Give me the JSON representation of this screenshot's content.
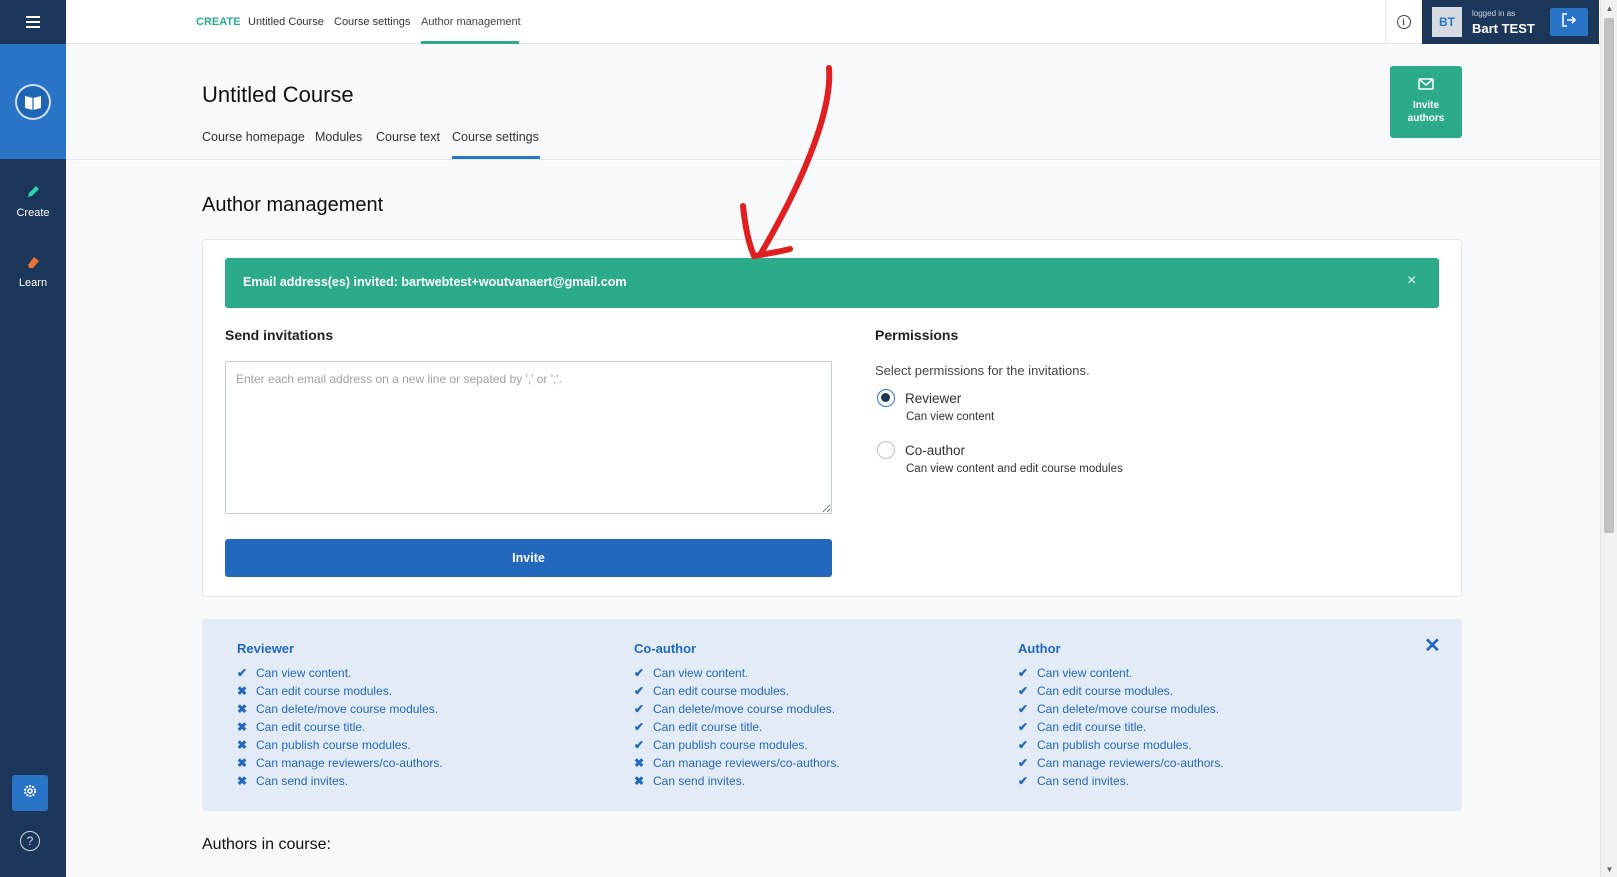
{
  "topbar": {
    "crumbs": [
      "CREATE",
      "Untitled Course",
      "Course settings",
      "Author management"
    ],
    "user": {
      "initials": "BT",
      "logged_in_label": "logged in as",
      "name": "Bart TEST"
    }
  },
  "sidebar": {
    "items": [
      {
        "label": "Create",
        "icon": "pencil-icon"
      },
      {
        "label": "Learn",
        "icon": "eraser-icon"
      }
    ]
  },
  "header": {
    "course_title": "Untitled Course",
    "tabs": [
      "Course homepage",
      "Modules",
      "Course text",
      "Course settings"
    ],
    "active_tab": "Course settings",
    "invite_authors_label": "Invite authors"
  },
  "main": {
    "section_title": "Author management",
    "alert": {
      "text": "Email address(es) invited: bartwebtest+woutvanaert@gmail.com",
      "close": "×"
    },
    "send": {
      "label": "Send invitations",
      "placeholder": "Enter each email address on a new line or sepated by ',' or ';'.",
      "button": "Invite"
    },
    "permissions": {
      "label": "Permissions",
      "subtitle": "Select permissions for the invitations.",
      "options": [
        {
          "label": "Reviewer",
          "desc": "Can view content",
          "checked": true
        },
        {
          "label": "Co-author",
          "desc": "Can view content and edit course modules",
          "checked": false
        }
      ]
    },
    "roles": [
      {
        "title": "Reviewer",
        "perms": [
          {
            "text": "Can view content.",
            "allowed": true
          },
          {
            "text": "Can edit course modules.",
            "allowed": false
          },
          {
            "text": "Can delete/move course modules.",
            "allowed": false
          },
          {
            "text": "Can edit course title.",
            "allowed": false
          },
          {
            "text": "Can publish course modules.",
            "allowed": false
          },
          {
            "text": "Can manage reviewers/co-authors.",
            "allowed": false
          },
          {
            "text": "Can send invites.",
            "allowed": false
          }
        ]
      },
      {
        "title": "Co-author",
        "perms": [
          {
            "text": "Can view content.",
            "allowed": true
          },
          {
            "text": "Can edit course modules.",
            "allowed": true
          },
          {
            "text": "Can delete/move course modules.",
            "allowed": true
          },
          {
            "text": "Can edit course title.",
            "allowed": true
          },
          {
            "text": "Can publish course modules.",
            "allowed": true
          },
          {
            "text": "Can manage reviewers/co-authors.",
            "allowed": false
          },
          {
            "text": "Can send invites.",
            "allowed": false
          }
        ]
      },
      {
        "title": "Author",
        "perms": [
          {
            "text": "Can view content.",
            "allowed": true
          },
          {
            "text": "Can edit course modules.",
            "allowed": true
          },
          {
            "text": "Can delete/move course modules.",
            "allowed": true
          },
          {
            "text": "Can edit course title.",
            "allowed": true
          },
          {
            "text": "Can publish course modules.",
            "allowed": true
          },
          {
            "text": "Can manage reviewers/co-authors.",
            "allowed": true
          },
          {
            "text": "Can send invites.",
            "allowed": true
          }
        ]
      }
    ],
    "authors_heading": "Authors in course:"
  },
  "colors": {
    "sidebar": "#1c3659",
    "accent_blue": "#2a74c8",
    "accent_green": "#2bab8a",
    "annotation_red": "#e02020"
  }
}
